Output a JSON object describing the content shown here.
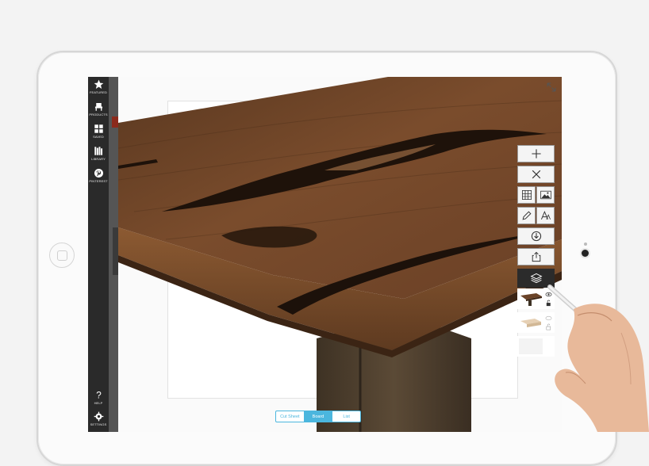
{
  "nav": {
    "items": [
      {
        "label": "FEATURED",
        "icon": "star-icon"
      },
      {
        "label": "PRODUCTS",
        "icon": "chair-icon"
      },
      {
        "label": "SAVED",
        "icon": "grid-icon"
      },
      {
        "label": "LIBRARY",
        "icon": "books-icon"
      },
      {
        "label": "PINTEREST",
        "icon": "pinterest-icon"
      }
    ],
    "bottom": [
      {
        "label": "HELP",
        "icon": "help-icon"
      },
      {
        "label": "SETTINGS",
        "icon": "gear-icon"
      }
    ]
  },
  "toolbar": {
    "tools": [
      "add-icon",
      "close-icon",
      "grid-icon",
      "image-icon",
      "pencil-icon",
      "text-icon",
      "download-icon",
      "share-icon",
      "layers-icon"
    ]
  },
  "layers": [
    {
      "name": "table",
      "visible": true,
      "locked": false
    },
    {
      "name": "bench",
      "visible": false,
      "locked": false
    },
    {
      "name": "empty",
      "visible": false,
      "locked": false
    }
  ],
  "view_modes": {
    "options": [
      "Cut Sheet",
      "Board",
      "List"
    ],
    "selected": "Board"
  },
  "colors": {
    "accent": "#4bb6de",
    "nav_background": "#2a2a2a",
    "wood": "#6a4328"
  }
}
